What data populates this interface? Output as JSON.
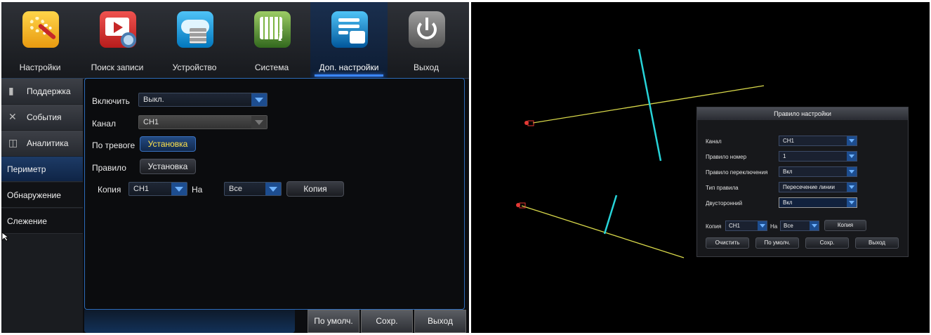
{
  "tabs": [
    {
      "label": "Настройки",
      "icon": "settings-gears-icon"
    },
    {
      "label": "Поиск записи",
      "icon": "record-search-icon"
    },
    {
      "label": "Устройство",
      "icon": "device-storage-icon"
    },
    {
      "label": "Система",
      "icon": "system-calendar-info-icon"
    },
    {
      "label": "Доп. настройки",
      "icon": "advanced-settings-icon"
    },
    {
      "label": "Выход",
      "icon": "power-icon"
    }
  ],
  "active_tab": "Доп. настройки",
  "sidebar": {
    "items": [
      {
        "label": "Поддержка",
        "icon": "mouse-icon"
      },
      {
        "label": "События",
        "icon": "tools-icon"
      },
      {
        "label": "Аналитика",
        "icon": "analytics-icon"
      },
      {
        "label": "Периметр"
      },
      {
        "label": "Обнаружение"
      },
      {
        "label": "Слежение"
      }
    ],
    "selected": "Периметр"
  },
  "form": {
    "enable_label": "Включить",
    "enable_value": "Выкл.",
    "channel_label": "Канал",
    "channel_value": "CH1",
    "alarm_label": "По тревоге",
    "alarm_button": "Установка",
    "rule_label": "Правило",
    "rule_button": "Установка",
    "copy_label": "Копия",
    "copy_from": "CH1",
    "copy_to_label": "На",
    "copy_to": "Все",
    "copy_button": "Копия"
  },
  "footer": {
    "default_button": "По умолч.",
    "save_button": "Сохр.",
    "exit_button": "Выход"
  },
  "rule_dialog": {
    "title": "Правило настройки",
    "channel_label": "Канал",
    "channel_value": "CH1",
    "rule_number_label": "Правило номер",
    "rule_number_value": "1",
    "rule_switch_label": "Правило переключения",
    "rule_switch_value": "Вкл",
    "rule_type_label": "Тип правила",
    "rule_type_value": "Пересечение линии",
    "bidirectional_label": "Двусторонний",
    "bidirectional_value": "Вкл",
    "copy_label": "Копия",
    "copy_from": "CH1",
    "copy_to_label": "На",
    "copy_to": "Все",
    "copy_button": "Копия",
    "clear_button": "Очистить",
    "default_button": "По умолч.",
    "save_button": "Сохр.",
    "exit_button": "Выход"
  },
  "colors": {
    "accent": "#2d6bb8",
    "highlight_text": "#ffe24a",
    "tripwire_line": "#d8d84a",
    "direction_arrow": "#27d3d8",
    "anchor_point": "#e53935"
  }
}
